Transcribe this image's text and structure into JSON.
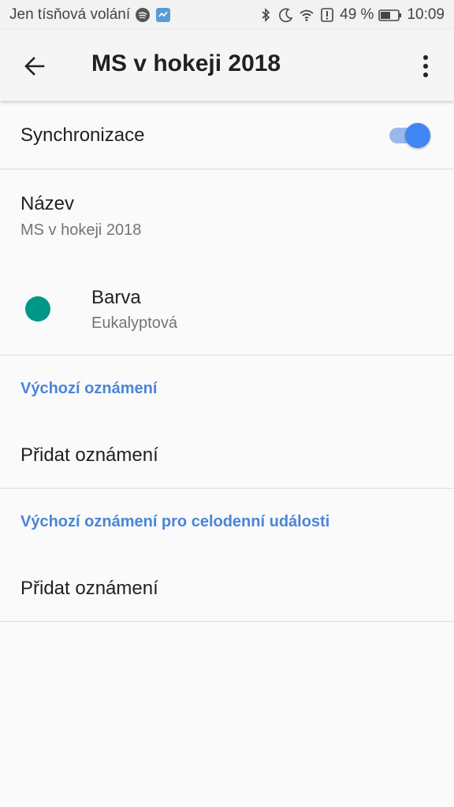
{
  "status_bar": {
    "carrier": "Jen tísňová volání",
    "battery": "49 %",
    "time": "10:09",
    "icons": [
      "spotify-icon",
      "notification-app-icon",
      "bluetooth-icon",
      "moon-icon",
      "wifi-icon",
      "alert-icon",
      "battery-icon"
    ]
  },
  "app_bar": {
    "title": "MS v hokeji 2018",
    "back_icon": "arrow-left-icon",
    "more_icon": "more-vertical-icon"
  },
  "settings": {
    "sync": {
      "label": "Synchronizace",
      "enabled": true
    },
    "name": {
      "title": "Název",
      "value": "MS v hokeji 2018"
    },
    "color": {
      "title": "Barva",
      "value": "Eukalyptová",
      "swatch": "#009688"
    },
    "default_notifications": {
      "header": "Výchozí oznámení",
      "add_label": "Přidat oznámení"
    },
    "allday_notifications": {
      "header": "Výchozí oznámení pro celodenní události",
      "add_label": "Přidat oznámení"
    }
  },
  "colors": {
    "accent": "#4285f4",
    "section_header": "#4a85d8",
    "toggle_track": "#9bb8ee"
  }
}
